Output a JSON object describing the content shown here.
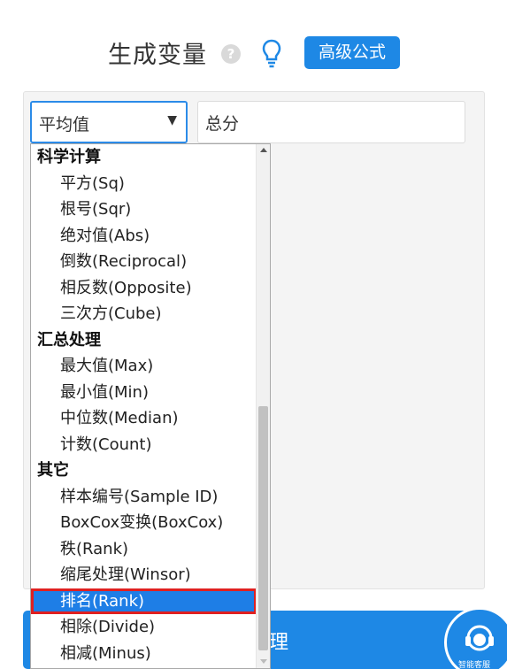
{
  "header": {
    "title": "生成变量",
    "help_icon": "?",
    "advanced_button": "高级公式"
  },
  "function_select": {
    "value": "平均值"
  },
  "name_input": {
    "value": "总分"
  },
  "dropdown": {
    "groups": [
      {
        "label": "科学计算",
        "options": [
          "平方(Sq)",
          "根号(Sqr)",
          "绝对值(Abs)",
          "倒数(Reciprocal)",
          "相反数(Opposite)",
          "三次方(Cube)"
        ]
      },
      {
        "label": "汇总处理",
        "options": [
          "最大值(Max)",
          "最小值(Min)",
          "中位数(Median)",
          "计数(Count)"
        ]
      },
      {
        "label": "其它",
        "options": [
          "样本编号(Sample ID)",
          "BoxCox变换(BoxCox)",
          "秩(Rank)",
          "缩尾处理(Winsor)",
          "排名(Rank)",
          "相除(Divide)",
          "相减(Minus)"
        ]
      }
    ],
    "selected": "排名(Rank)"
  },
  "bottom_button": {
    "label": "理"
  },
  "service": {
    "label": "智能客服"
  },
  "colors": {
    "accent": "#1e88e5",
    "highlight_border": "#e02020"
  },
  "icons": {
    "help": "help-icon",
    "bulb": "bulb-icon",
    "caret": "caret-down-icon",
    "service": "headset-icon"
  }
}
